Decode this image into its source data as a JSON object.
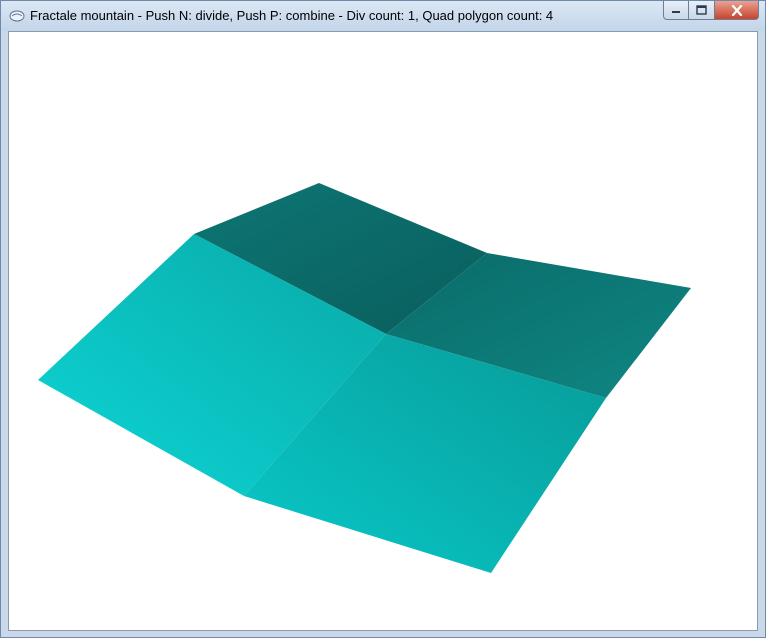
{
  "window": {
    "title": "Fractale mountain - Push N: divide, Push P: combine - Div count: 1, Quad polygon count: 4"
  },
  "controls": {
    "minimize_icon": "minimize-icon",
    "maximize_icon": "maximize-icon",
    "close_icon": "close-icon"
  },
  "scene": {
    "description_icon": "app-icon",
    "quad_colors": {
      "back_left": "#0b6563",
      "back_right": "#0c807c",
      "front_left": "#0bc6c6",
      "front_right": "#07b6b4"
    }
  }
}
